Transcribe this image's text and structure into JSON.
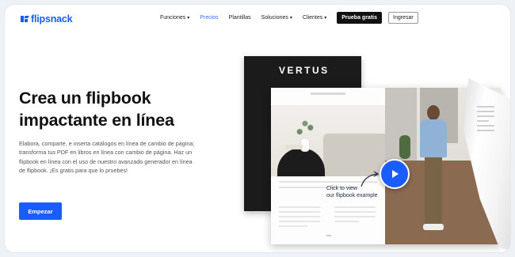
{
  "brand": {
    "name": "flipsnack",
    "color": "#1a5cff"
  },
  "nav": {
    "items": [
      {
        "label": "Funciones",
        "dropdown": true,
        "active": false
      },
      {
        "label": "Precios",
        "dropdown": false,
        "active": true
      },
      {
        "label": "Plantillas",
        "dropdown": false,
        "active": false
      },
      {
        "label": "Soluciones",
        "dropdown": true,
        "active": false
      },
      {
        "label": "Clientes",
        "dropdown": true,
        "active": false
      }
    ],
    "trial_button": "Prueba gratis",
    "login_button": "Ingresar"
  },
  "hero": {
    "headline_line1": "Crea un flipbook",
    "headline_line2": "impactante en línea",
    "description": "Elabora, comparte, e inserta catálogos en línea de cambio de página; transforma tus PDF en libros en línea con cambio de página. Haz un flipbook en línea con el uso de nuestro avanzado generador en línea de flipbook. ¡Es gratis para que lo pruebes!",
    "cta_button": "Empezar"
  },
  "preview": {
    "cover_brand": "VERTUS",
    "video_note_line1": "Click to view",
    "video_note_line2": "our flipbook example",
    "play_icon": "play-icon"
  },
  "colors": {
    "accent": "#1a5cff",
    "text_dark": "#111111",
    "cover": "#1b1b1b"
  }
}
